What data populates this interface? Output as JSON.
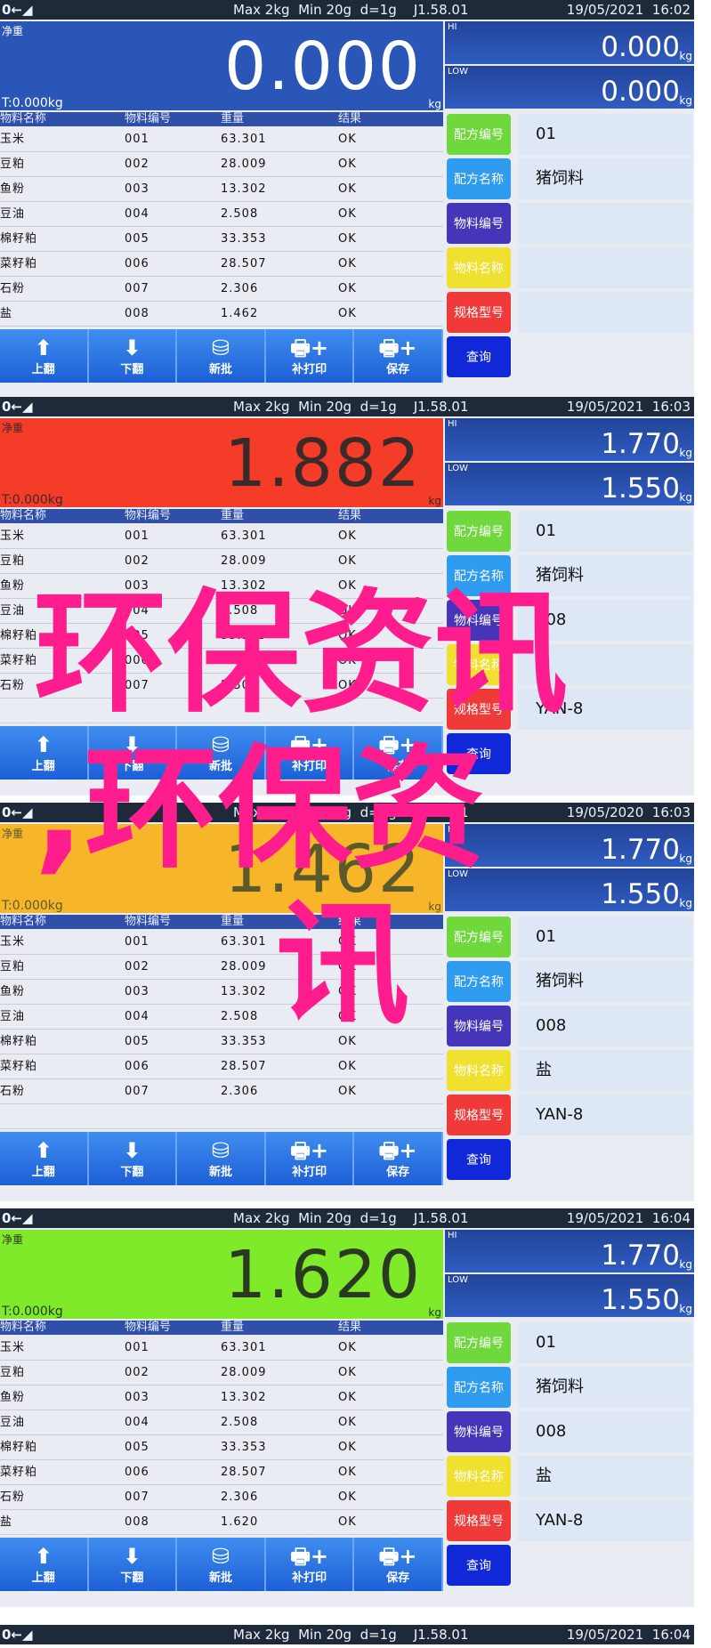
{
  "screens": [
    {
      "status": {
        "zero_icon": "0←◢",
        "spec": "Max 2kg  Min 20g  d=1g    J1.58.01",
        "datetime": "19/05/2021  16:02"
      },
      "main": {
        "label": "净重",
        "value": "0.000",
        "unit": "kg",
        "tare": "T:0.000kg",
        "bg": "#2a56b8",
        "fg": "#ffffff"
      },
      "hi": {
        "label": "HI",
        "value": "0.000",
        "unit": "kg"
      },
      "low": {
        "label": "LOW",
        "value": "0.000",
        "unit": "kg"
      },
      "rows": [
        {
          "name": "玉米",
          "code": "001",
          "weight": "63.301",
          "result": "OK"
        },
        {
          "name": "豆粕",
          "code": "002",
          "weight": "28.009",
          "result": "OK"
        },
        {
          "name": "鱼粉",
          "code": "003",
          "weight": "13.302",
          "result": "OK"
        },
        {
          "name": "豆油",
          "code": "004",
          "weight": "2.508",
          "result": "OK"
        },
        {
          "name": "棉籽粕",
          "code": "005",
          "weight": "33.353",
          "result": "OK"
        },
        {
          "name": "菜籽粕",
          "code": "006",
          "weight": "28.507",
          "result": "OK"
        },
        {
          "name": "石粉",
          "code": "007",
          "weight": "2.306",
          "result": "OK"
        },
        {
          "name": "盐",
          "code": "008",
          "weight": "1.462",
          "result": "OK"
        }
      ],
      "fields": [
        "01",
        "猪饲料",
        "",
        "",
        ""
      ]
    },
    {
      "status": {
        "zero_icon": "0←◢",
        "spec": "Max 2kg  Min 20g  d=1g    J1.58.01",
        "datetime": "19/05/2021  16:03"
      },
      "main": {
        "label": "净重",
        "value": "1.882",
        "unit": "kg",
        "tare": "T:0.000kg",
        "bg": "#f53c28",
        "fg": "#3a2a2a"
      },
      "hi": {
        "label": "HI",
        "value": "1.770",
        "unit": "kg"
      },
      "low": {
        "label": "LOW",
        "value": "1.550",
        "unit": "kg"
      },
      "rows": [
        {
          "name": "玉米",
          "code": "001",
          "weight": "63.301",
          "result": "OK"
        },
        {
          "name": "豆粕",
          "code": "002",
          "weight": "28.009",
          "result": "OK"
        },
        {
          "name": "鱼粉",
          "code": "003",
          "weight": "13.302",
          "result": "OK"
        },
        {
          "name": "豆油",
          "code": "004",
          "weight": "2.508",
          "result": "OK"
        },
        {
          "name": "棉籽粕",
          "code": "005",
          "weight": "33.353",
          "result": "OK"
        },
        {
          "name": "菜籽粕",
          "code": "006",
          "weight": "28.507",
          "result": "OK"
        },
        {
          "name": "石粉",
          "code": "007",
          "weight": "2.306",
          "result": "OK"
        }
      ],
      "fields": [
        "01",
        "猪饲料",
        "008",
        "",
        "YAN-8"
      ]
    },
    {
      "status": {
        "zero_icon": "0←◢",
        "spec": "Max 2kg  Min 20g  d=1g    J1.58.01",
        "datetime": "19/05/2020  16:03"
      },
      "main": {
        "label": "净重",
        "value": "1.462",
        "unit": "kg",
        "tare": "T:0.000kg",
        "bg": "#f7b52a",
        "fg": "#5a5a2a"
      },
      "hi": {
        "label": "HI",
        "value": "1.770",
        "unit": "kg"
      },
      "low": {
        "label": "LOW",
        "value": "1.550",
        "unit": "kg"
      },
      "rows": [
        {
          "name": "玉米",
          "code": "001",
          "weight": "63.301",
          "result": "OK"
        },
        {
          "name": "豆粕",
          "code": "002",
          "weight": "28.009",
          "result": "OK"
        },
        {
          "name": "鱼粉",
          "code": "003",
          "weight": "13.302",
          "result": "OK"
        },
        {
          "name": "豆油",
          "code": "004",
          "weight": "2.508",
          "result": "OK"
        },
        {
          "name": "棉籽粕",
          "code": "005",
          "weight": "33.353",
          "result": "OK"
        },
        {
          "name": "菜籽粕",
          "code": "006",
          "weight": "28.507",
          "result": "OK"
        },
        {
          "name": "石粉",
          "code": "007",
          "weight": "2.306",
          "result": "OK"
        }
      ],
      "fields": [
        "01",
        "猪饲料",
        "008",
        "盐",
        "YAN-8"
      ]
    },
    {
      "status": {
        "zero_icon": "0←◢",
        "spec": "Max 2kg  Min 20g  d=1g    J1.58.01",
        "datetime": "19/05/2021  16:04"
      },
      "main": {
        "label": "净重",
        "value": "1.620",
        "unit": "kg",
        "tare": "T:0.000kg",
        "bg": "#7fea2a",
        "fg": "#2a3a22"
      },
      "hi": {
        "label": "HI",
        "value": "1.770",
        "unit": "kg"
      },
      "low": {
        "label": "LOW",
        "value": "1.550",
        "unit": "kg"
      },
      "rows": [
        {
          "name": "玉米",
          "code": "001",
          "weight": "63.301",
          "result": "OK"
        },
        {
          "name": "豆粕",
          "code": "002",
          "weight": "28.009",
          "result": "OK"
        },
        {
          "name": "鱼粉",
          "code": "003",
          "weight": "13.302",
          "result": "OK"
        },
        {
          "name": "豆油",
          "code": "004",
          "weight": "2.508",
          "result": "OK"
        },
        {
          "name": "棉籽粕",
          "code": "005",
          "weight": "33.353",
          "result": "OK"
        },
        {
          "name": "菜籽粕",
          "code": "006",
          "weight": "28.507",
          "result": "OK"
        },
        {
          "name": "石粉",
          "code": "007",
          "weight": "2.306",
          "result": "OK"
        },
        {
          "name": "盐",
          "code": "008",
          "weight": "1.620",
          "result": "OK"
        }
      ],
      "fields": [
        "01",
        "猪饲料",
        "008",
        "盐",
        "YAN-8"
      ]
    }
  ],
  "table_headers": [
    "物料名称",
    "物料编号",
    "重量",
    "结果"
  ],
  "buttons": [
    {
      "label": "上翻",
      "icon": "arrow-up-icon",
      "glyph": "⬆"
    },
    {
      "label": "下翻",
      "icon": "arrow-down-icon",
      "glyph": "⬇"
    },
    {
      "label": "新批",
      "icon": "batch-stack-icon",
      "glyph": "⛁"
    },
    {
      "label": "补打印",
      "icon": "printer-plus-icon",
      "glyph": "🖶+"
    },
    {
      "label": "保存",
      "icon": "save-printer-icon",
      "glyph": "🖶+"
    }
  ],
  "side_buttons": [
    {
      "label": "配方编号",
      "color": "#6fd83c"
    },
    {
      "label": "配方名称",
      "color": "#2f9cf0"
    },
    {
      "label": "物料编号",
      "color": "#4535b8"
    },
    {
      "label": "物料名称",
      "color": "#f0e030"
    },
    {
      "label": "规格型号",
      "color": "#f03a3a"
    },
    {
      "label": "查询",
      "color": "#1028d8"
    }
  ],
  "bottom_status": {
    "zero_icon": "0←◢",
    "spec": "Max 2kg  Min 20g  d=1g    J1.58.01",
    "datetime": "19/05/2021  16:04"
  },
  "watermark": {
    "line1": "环保资讯",
    "line2": ",环保资",
    "line3": "讯",
    "color": "#ff1d8e"
  }
}
